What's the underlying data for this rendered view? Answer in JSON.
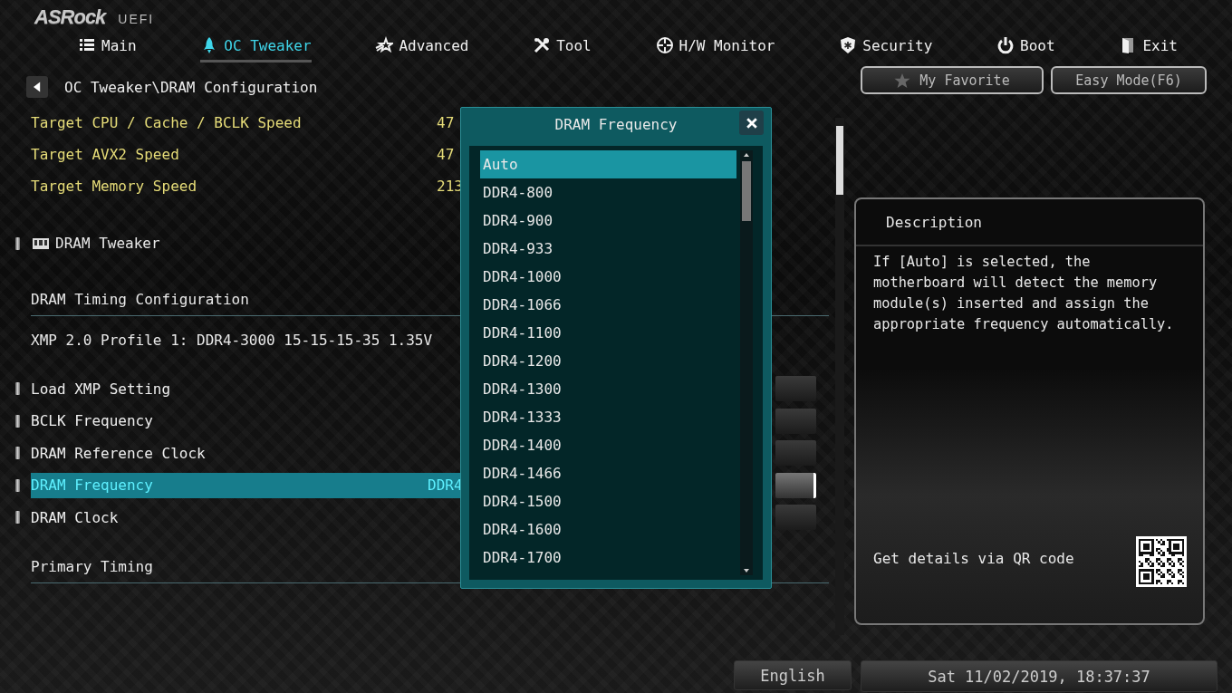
{
  "logo": {
    "brand": "ASRock",
    "product": "UEFI"
  },
  "tabs": [
    {
      "label": "Main",
      "selected": false
    },
    {
      "label": "OC Tweaker",
      "selected": true
    },
    {
      "label": "Advanced",
      "selected": false
    },
    {
      "label": "Tool",
      "selected": false
    },
    {
      "label": "H/W Monitor",
      "selected": false
    },
    {
      "label": "Security",
      "selected": false
    },
    {
      "label": "Boot",
      "selected": false
    },
    {
      "label": "Exit",
      "selected": false
    }
  ],
  "breadcrumb": "OC Tweaker\\DRAM Configuration",
  "top_buttons": [
    {
      "label": "My Favorite"
    },
    {
      "label": "Easy Mode(F6)"
    }
  ],
  "settings": [
    {
      "kind": "info",
      "label": "Target CPU / Cache / BCLK Speed",
      "value": "47"
    },
    {
      "kind": "info",
      "label": "Target AVX2 Speed",
      "value": "47"
    },
    {
      "kind": "info",
      "label": "Target Memory Speed",
      "value": "213"
    },
    {
      "kind": "submenu",
      "label": "DRAM Tweaker"
    },
    {
      "kind": "heading",
      "label": "DRAM Timing Configuration"
    },
    {
      "kind": "text",
      "label": "XMP 2.0 Profile 1: DDR4-3000 15-15-15-35 1.35V"
    },
    {
      "kind": "option",
      "label": "Load XMP Setting",
      "selected": false
    },
    {
      "kind": "option",
      "label": "BCLK Frequency",
      "selected": false
    },
    {
      "kind": "option",
      "label": "DRAM Reference Clock",
      "selected": false
    },
    {
      "kind": "option",
      "label": "DRAM Frequency",
      "value": "DDR4",
      "selected": true
    },
    {
      "kind": "option",
      "label": "DRAM Clock",
      "selected": false
    },
    {
      "kind": "heading",
      "label": "Primary Timing"
    }
  ],
  "popup": {
    "title": "DRAM Frequency",
    "options": [
      {
        "label": "Auto",
        "selected": true
      },
      {
        "label": "DDR4-800",
        "selected": false
      },
      {
        "label": "DDR4-900",
        "selected": false
      },
      {
        "label": "DDR4-933",
        "selected": false
      },
      {
        "label": "DDR4-1000",
        "selected": false
      },
      {
        "label": "DDR4-1066",
        "selected": false
      },
      {
        "label": "DDR4-1100",
        "selected": false
      },
      {
        "label": "DDR4-1200",
        "selected": false
      },
      {
        "label": "DDR4-1300",
        "selected": false
      },
      {
        "label": "DDR4-1333",
        "selected": false
      },
      {
        "label": "DDR4-1400",
        "selected": false
      },
      {
        "label": "DDR4-1466",
        "selected": false
      },
      {
        "label": "DDR4-1500",
        "selected": false
      },
      {
        "label": "DDR4-1600",
        "selected": false
      },
      {
        "label": "DDR4-1700",
        "selected": false
      }
    ]
  },
  "description": {
    "title": "Description",
    "text": "If [Auto] is selected, the motherboard will detect the memory module(s) inserted and assign the appropriate frequency automatically.",
    "qr_caption": "Get details via QR code"
  },
  "footer": {
    "language": "English",
    "datetime": "Sat 11/02/2019, 18:37:37"
  }
}
